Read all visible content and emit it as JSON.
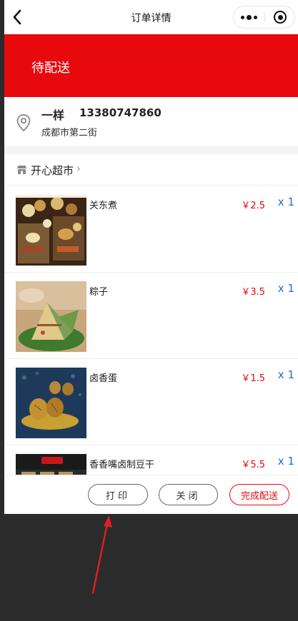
{
  "navbar": {
    "title": "订单详情"
  },
  "status": {
    "text": "待配送"
  },
  "address": {
    "name": "一样",
    "phone": "13380747860",
    "detail": "成都市第二街"
  },
  "store": {
    "name": "开心超市",
    "chevron": "›"
  },
  "items": [
    {
      "name": "关东煮",
      "price": "￥2.5",
      "qty": "x 1",
      "image": "oden-food-photo"
    },
    {
      "name": "粽子",
      "price": "￥3.5",
      "qty": "x 1",
      "image": "zongzi-food-photo"
    },
    {
      "name": "卤香蛋",
      "price": "￥1.5",
      "qty": "x 1",
      "image": "tea-egg-food-photo"
    },
    {
      "name": "香香嘴卤制豆干",
      "price": "￥5.5",
      "qty": "x 1",
      "image": "tofu-snack-package-photo"
    }
  ],
  "actions": {
    "print": "打印",
    "close": "关闭",
    "complete": "完成配送"
  },
  "colors": {
    "brand_red": "#e8090e",
    "quantity_blue": "#1a6fd3",
    "background_dark": "#2b2b2b"
  }
}
